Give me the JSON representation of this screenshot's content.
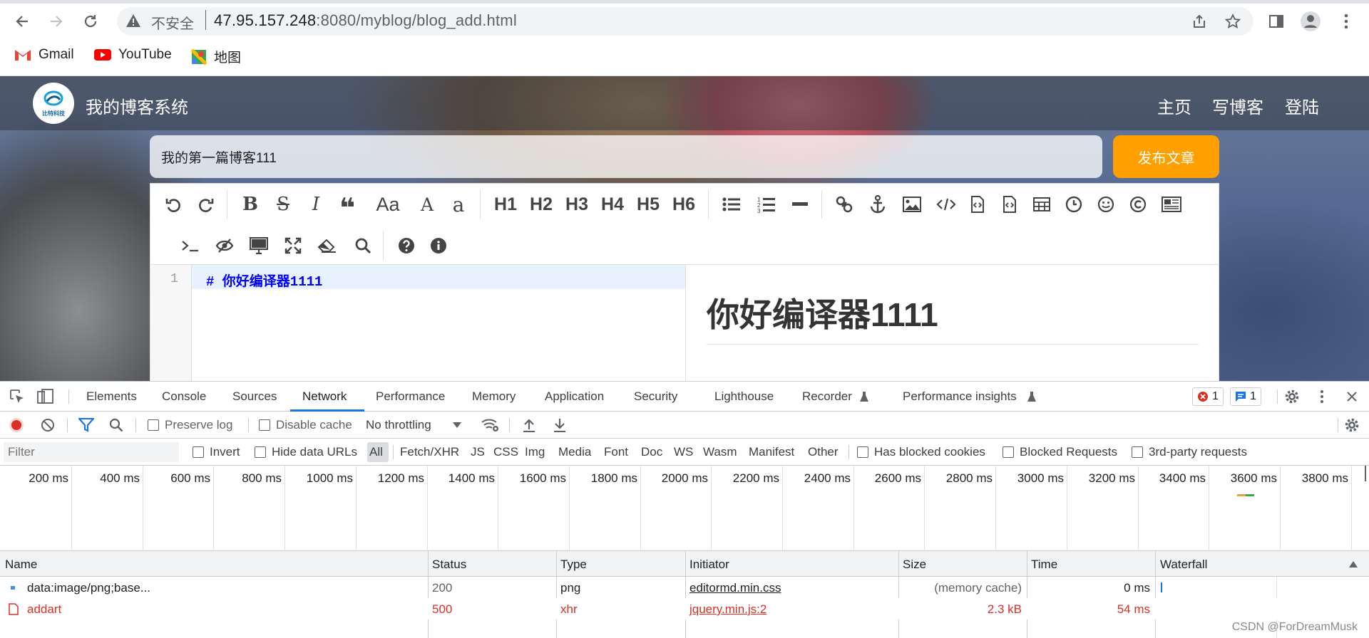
{
  "browser": {
    "url_secure_label": "不安全",
    "url_host": "47.95.157.248",
    "url_rest": ":8080/myblog/blog_add.html",
    "bookmarks": [
      {
        "label": "Gmail"
      },
      {
        "label": "YouTube"
      },
      {
        "label": "地图"
      }
    ]
  },
  "site": {
    "logo_text": "比特科技",
    "title": "我的博客系统",
    "nav": [
      {
        "label": "主页"
      },
      {
        "label": "写博客"
      },
      {
        "label": "登陆"
      }
    ],
    "blog_title_value": "我的第一篇博客111",
    "publish_label": "发布文章"
  },
  "editor": {
    "toolbar_text": [
      "Aa",
      "A",
      "a",
      "H1",
      "H2",
      "H3",
      "H4",
      "H5",
      "H6"
    ],
    "line_number": "1",
    "code_line": "# 你好编译器1111",
    "preview_heading": "你好编译器1111"
  },
  "devtools": {
    "tabs": [
      "Elements",
      "Console",
      "Sources",
      "Network",
      "Performance",
      "Memory",
      "Application",
      "Security",
      "Lighthouse",
      "Recorder",
      "Performance insights"
    ],
    "active_tab": "Network",
    "error_count": "1",
    "message_count": "1",
    "toolbar": {
      "preserve_log": "Preserve log",
      "disable_cache": "Disable cache",
      "throttling": "No throttling"
    },
    "filter": {
      "placeholder": "Filter",
      "invert": "Invert",
      "hide_data_urls": "Hide data URLs",
      "types": [
        "All",
        "Fetch/XHR",
        "JS",
        "CSS",
        "Img",
        "Media",
        "Font",
        "Doc",
        "WS",
        "Wasm",
        "Manifest",
        "Other"
      ],
      "has_blocked_cookies": "Has blocked cookies",
      "blocked_requests": "Blocked Requests",
      "third_party": "3rd-party requests"
    },
    "timeline_ticks": [
      "200 ms",
      "400 ms",
      "600 ms",
      "800 ms",
      "1000 ms",
      "1200 ms",
      "1400 ms",
      "1600 ms",
      "1800 ms",
      "2000 ms",
      "2200 ms",
      "2400 ms",
      "2600 ms",
      "2800 ms",
      "3000 ms",
      "3200 ms",
      "3400 ms",
      "3600 ms",
      "3800 ms"
    ],
    "columns": [
      "Name",
      "Status",
      "Type",
      "Initiator",
      "Size",
      "Time",
      "Waterfall"
    ],
    "rows": [
      {
        "name": "data:image/png;base...",
        "status": "200",
        "type": "png",
        "initiator": "editormd.min.css",
        "size": "(memory cache)",
        "time": "0 ms",
        "error": false
      },
      {
        "name": "addart",
        "status": "500",
        "type": "xhr",
        "initiator": "jquery.min.js:2",
        "size": "2.3 kB",
        "time": "54 ms",
        "error": true
      }
    ]
  },
  "watermark": "CSDN @ForDreamMusk",
  "colors": {
    "accent": "#1a73e8",
    "error": "#d93025",
    "publish": "#ff9f00",
    "code": "#0000ff"
  }
}
